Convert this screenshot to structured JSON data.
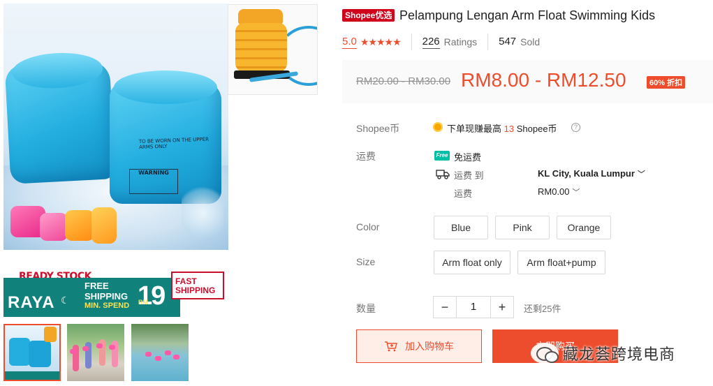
{
  "gallery": {
    "main_image_alt": "Blue inflatable arm float swimming bands",
    "float_print": "TO BE WORN ON THE UPPER ARMS ONLY",
    "warning_print": "WARNING",
    "pump_image_alt": "Foot air pump with hose",
    "banner": {
      "ready_stock": "READY STOCK",
      "raya": "RAYA",
      "free": "FREE",
      "shipping": "SHIPPING",
      "min_spend": "MIN. SPEND",
      "rm": "RM",
      "amount": "19",
      "fast_shipping": "FAST SHIPPING"
    },
    "thumbnails": [
      "arm-floats-and-pump",
      "kids-wearing-floats",
      "kids-in-pool"
    ]
  },
  "product": {
    "badge": "Shopee优选",
    "title": "Pelampung Lengan Arm Float Swimming Kids",
    "rating": "5.0",
    "stars": "★★★★★",
    "ratings_count": "226",
    "ratings_label": "Ratings",
    "sold_count": "547",
    "sold_label": "Sold"
  },
  "price": {
    "original": "RM20.00 - RM30.00",
    "current": "RM8.00 - RM12.50",
    "discount": "60% 折扣"
  },
  "coins": {
    "label": "Shopee币",
    "text_before": "下单现赚最高",
    "amount": "13",
    "text_after": "Shopee币",
    "help_icon": "?"
  },
  "shipping": {
    "label": "运费",
    "free_icon_text": "Free",
    "free_text": "免运费",
    "to_label": "运费 到",
    "location": "KL City, Kuala Lumpur",
    "fee_label": "运费",
    "fee": "RM0.00"
  },
  "color": {
    "label": "Color",
    "options": [
      "Blue",
      "Pink",
      "Orange"
    ]
  },
  "size": {
    "label": "Size",
    "options": [
      "Arm float only",
      "Arm float+pump"
    ]
  },
  "quantity": {
    "label": "数量",
    "minus": "−",
    "value": "1",
    "plus": "+",
    "stock": "还剩25件"
  },
  "actions": {
    "add_to_cart": "加入购物车",
    "buy_now": "立即购买"
  },
  "watermark": {
    "text": "藏龙荟跨境电商"
  },
  "colors": {
    "accent": "#ee4d2d",
    "badge_red": "#d0011b",
    "banner_teal": "#10827b",
    "free_ship_teal": "#00bfa5"
  }
}
